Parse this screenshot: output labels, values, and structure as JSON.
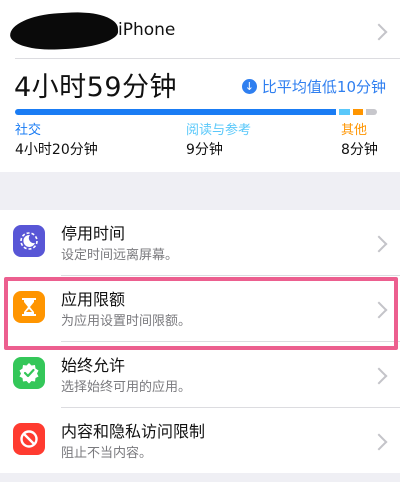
{
  "device": {
    "name_suffix": "iPhone"
  },
  "summary": {
    "total_time": "4小时59分钟",
    "compare_text": "比平均值低10分钟",
    "compare_icon": "arrow-down-circle-icon"
  },
  "usage_bar": {
    "segments": [
      {
        "category": "社交",
        "fraction": 0.868,
        "color": "#1a7cf4"
      },
      {
        "category": "阅读与参考",
        "fraction": 0.03,
        "color": "#5ac8fa"
      },
      {
        "category": "其他",
        "fraction": 0.027,
        "color": "#ff9500"
      },
      {
        "category": "rest",
        "fraction": 0.03,
        "color": "#c7c7cc"
      }
    ]
  },
  "categories": [
    {
      "label": "社交",
      "value": "4小时20分钟",
      "color": "#1a7cf4"
    },
    {
      "label": "阅读与参考",
      "value": "9分钟",
      "color": "#5ac8fa"
    },
    {
      "label": "其他",
      "value": "8分钟",
      "color": "#ff9500"
    }
  ],
  "settings": [
    {
      "title": "停用时间",
      "subtitle": "设定时间远离屏幕。",
      "icon": "moon-clock-icon",
      "icon_bg": "#5856d6"
    },
    {
      "title": "应用限额",
      "subtitle": "为应用设置时间限额。",
      "icon": "hourglass-icon",
      "icon_bg": "#ff9500"
    },
    {
      "title": "始终允许",
      "subtitle": "选择始终可用的应用。",
      "icon": "checkmark-badge-icon",
      "icon_bg": "#34c759"
    },
    {
      "title": "内容和隐私访问限制",
      "subtitle": "阻止不当内容。",
      "icon": "restricted-icon",
      "icon_bg": "#ff3b30"
    }
  ],
  "colors": {
    "accent": "#2f7ff0",
    "highlight_border": "#ec5f8f"
  }
}
